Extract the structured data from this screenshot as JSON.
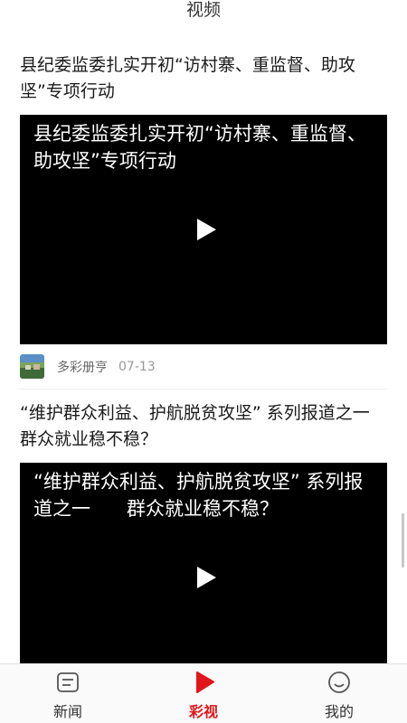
{
  "header": {
    "title": "视频"
  },
  "videos": [
    {
      "title": "县纪委监委扎实开初“访村寨、重监督、助攻坚”专项行动",
      "overlay_title": "县纪委监委扎实开初“访村寨、重监督、助攻坚”专项行动",
      "source": "多彩册亨",
      "date": "07-13"
    },
    {
      "title": "“维护群众利益、护航脱贫攻坚” 系列报道之一 群众就业稳不稳？",
      "overlay_title": "“维护群众利益、护航脱贫攻坚” 系列报道之一      群众就业稳不稳？"
    }
  ],
  "tabs": [
    {
      "label": "新闻",
      "icon": "news-icon"
    },
    {
      "label": "彩视",
      "icon": "video-play-icon",
      "active": true
    },
    {
      "label": "我的",
      "icon": "smiley-profile-icon"
    }
  ],
  "colors": {
    "accent": "#e0161b",
    "player_bg": "#000000"
  }
}
